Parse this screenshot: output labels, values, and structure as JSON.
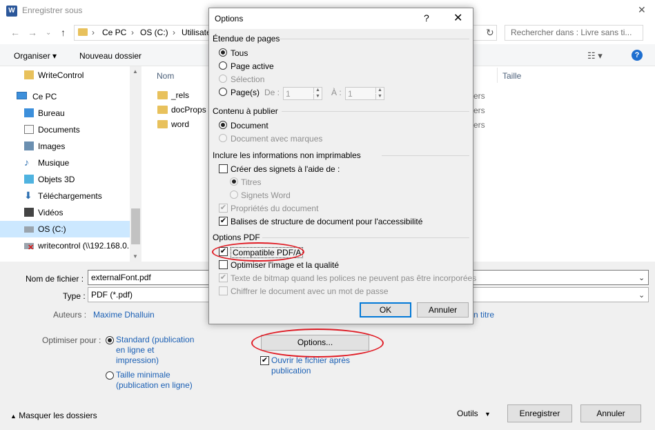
{
  "window": {
    "title": "Enregistrer sous",
    "close_icon": "close-icon"
  },
  "address": {
    "breadcrumbs": [
      "Ce PC",
      "OS (C:)",
      "Utilisate"
    ],
    "search_placeholder": "Rechercher dans : Livre sans ti..."
  },
  "toolbar": {
    "organize": "Organiser",
    "new_folder": "Nouveau dossier"
  },
  "nav": {
    "items": [
      {
        "label": "WriteControl",
        "icon": "folder-icon"
      },
      {
        "label": "Ce PC",
        "icon": "computer-icon"
      },
      {
        "label": "Bureau",
        "icon": "desktop-icon"
      },
      {
        "label": "Documents",
        "icon": "documents-icon"
      },
      {
        "label": "Images",
        "icon": "images-icon"
      },
      {
        "label": "Musique",
        "icon": "music-icon"
      },
      {
        "label": "Objets 3D",
        "icon": "cube-icon"
      },
      {
        "label": "Téléchargements",
        "icon": "download-icon"
      },
      {
        "label": "Vidéos",
        "icon": "video-icon"
      },
      {
        "label": "OS (C:)",
        "icon": "drive-icon",
        "selected": true
      },
      {
        "label": "writecontrol (\\\\192.168.0.1",
        "icon": "network-drive-icon"
      }
    ]
  },
  "files": {
    "col_name": "Nom",
    "col_size": "Taille",
    "rows": [
      {
        "name": "_rels",
        "type_frag": "ers"
      },
      {
        "name": "docProps",
        "type_frag": "ers"
      },
      {
        "name": "word",
        "type_frag": "ers"
      }
    ]
  },
  "form": {
    "filename_label": "Nom de fichier :",
    "filename_value": "externalFont.pdf",
    "type_label": "Type :",
    "type_value": "PDF (*.pdf)",
    "authors_label": "Auteurs :",
    "authors_value": "Maxime Dhalluin",
    "title_frag": "n titre",
    "optimize_label": "Optimiser pour :",
    "opt_standard": [
      "Standard (publication",
      "en ligne et",
      "impression)"
    ],
    "opt_minimal": [
      "Taille minimale",
      "(publication en ligne)"
    ],
    "options_button": "Options...",
    "open_after": [
      "Ouvrir le fichier après",
      "publication"
    ]
  },
  "footer": {
    "hide_folders": "Masquer les dossiers",
    "tools": "Outils",
    "save": "Enregistrer",
    "cancel": "Annuler"
  },
  "modal": {
    "title": "Options",
    "help": "?",
    "close": "✕",
    "page_range": {
      "heading": "Étendue de pages",
      "all": "Tous",
      "current": "Page active",
      "selection": "Sélection",
      "pages": "Page(s)",
      "from_label": "De :",
      "from_value": "1",
      "to_label": "À :",
      "to_value": "1"
    },
    "publish": {
      "heading": "Contenu à publier",
      "document": "Document",
      "document_markup": "Document avec marques"
    },
    "nonprint": {
      "heading": "Inclure les informations non imprimables",
      "bookmarks": "Créer des signets à l'aide de :",
      "headings": "Titres",
      "word_bookmarks": "Signets Word",
      "doc_props": "Propriétés du document",
      "structure_tags": "Balises de structure de document pour l'accessibilité"
    },
    "pdf": {
      "heading": "Options PDF",
      "pdfa": "Compatible PDF/A",
      "optimize_image": "Optimiser l'image et la qualité",
      "bitmap_text": "Texte de bitmap quand les polices ne peuvent pas être incorporées",
      "encrypt": "Chiffrer le document avec un mot de passe"
    },
    "ok": "OK",
    "cancel": "Annuler"
  },
  "colors": {
    "accent": "#0078d7",
    "link": "#1a5fb4",
    "annotation": "#e01b24",
    "selection": "#cce8ff"
  }
}
